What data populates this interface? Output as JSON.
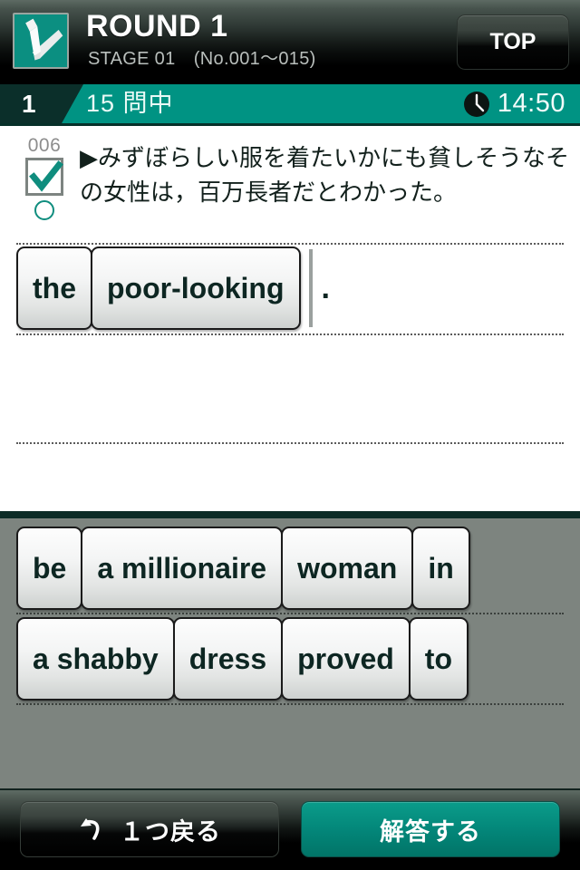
{
  "header": {
    "title": "ROUND 1",
    "subtitle": "STAGE 01　(No.001〜015)",
    "top_button_label": "TOP",
    "app_icon": "check-pencil-icon"
  },
  "progress": {
    "current": "1",
    "label": "15 問中",
    "timer": "14:50",
    "clock_icon": "clock-icon"
  },
  "question": {
    "number": "006",
    "check_icon": "check-icon",
    "circle_icon": "circle-icon",
    "text": "▶みずぼらしい服を着たいかにも貧しそうなその女性は，百万長者だとわかった。"
  },
  "answer": {
    "tiles": [
      "the",
      "poor-looking"
    ],
    "punctuation": "."
  },
  "wordbank": {
    "rows": [
      [
        "be",
        "a millionaire",
        "woman",
        "in"
      ],
      [
        "a shabby",
        "dress",
        "proved",
        "to"
      ]
    ]
  },
  "footer": {
    "undo_label": "１つ戻る",
    "undo_icon": "undo-arrow-icon",
    "submit_label": "解答する"
  },
  "colors": {
    "accent_teal": "#009383",
    "dark_teal": "#0b2f2a",
    "bank_gray": "#7d847f",
    "tile_text": "#0d2622"
  }
}
